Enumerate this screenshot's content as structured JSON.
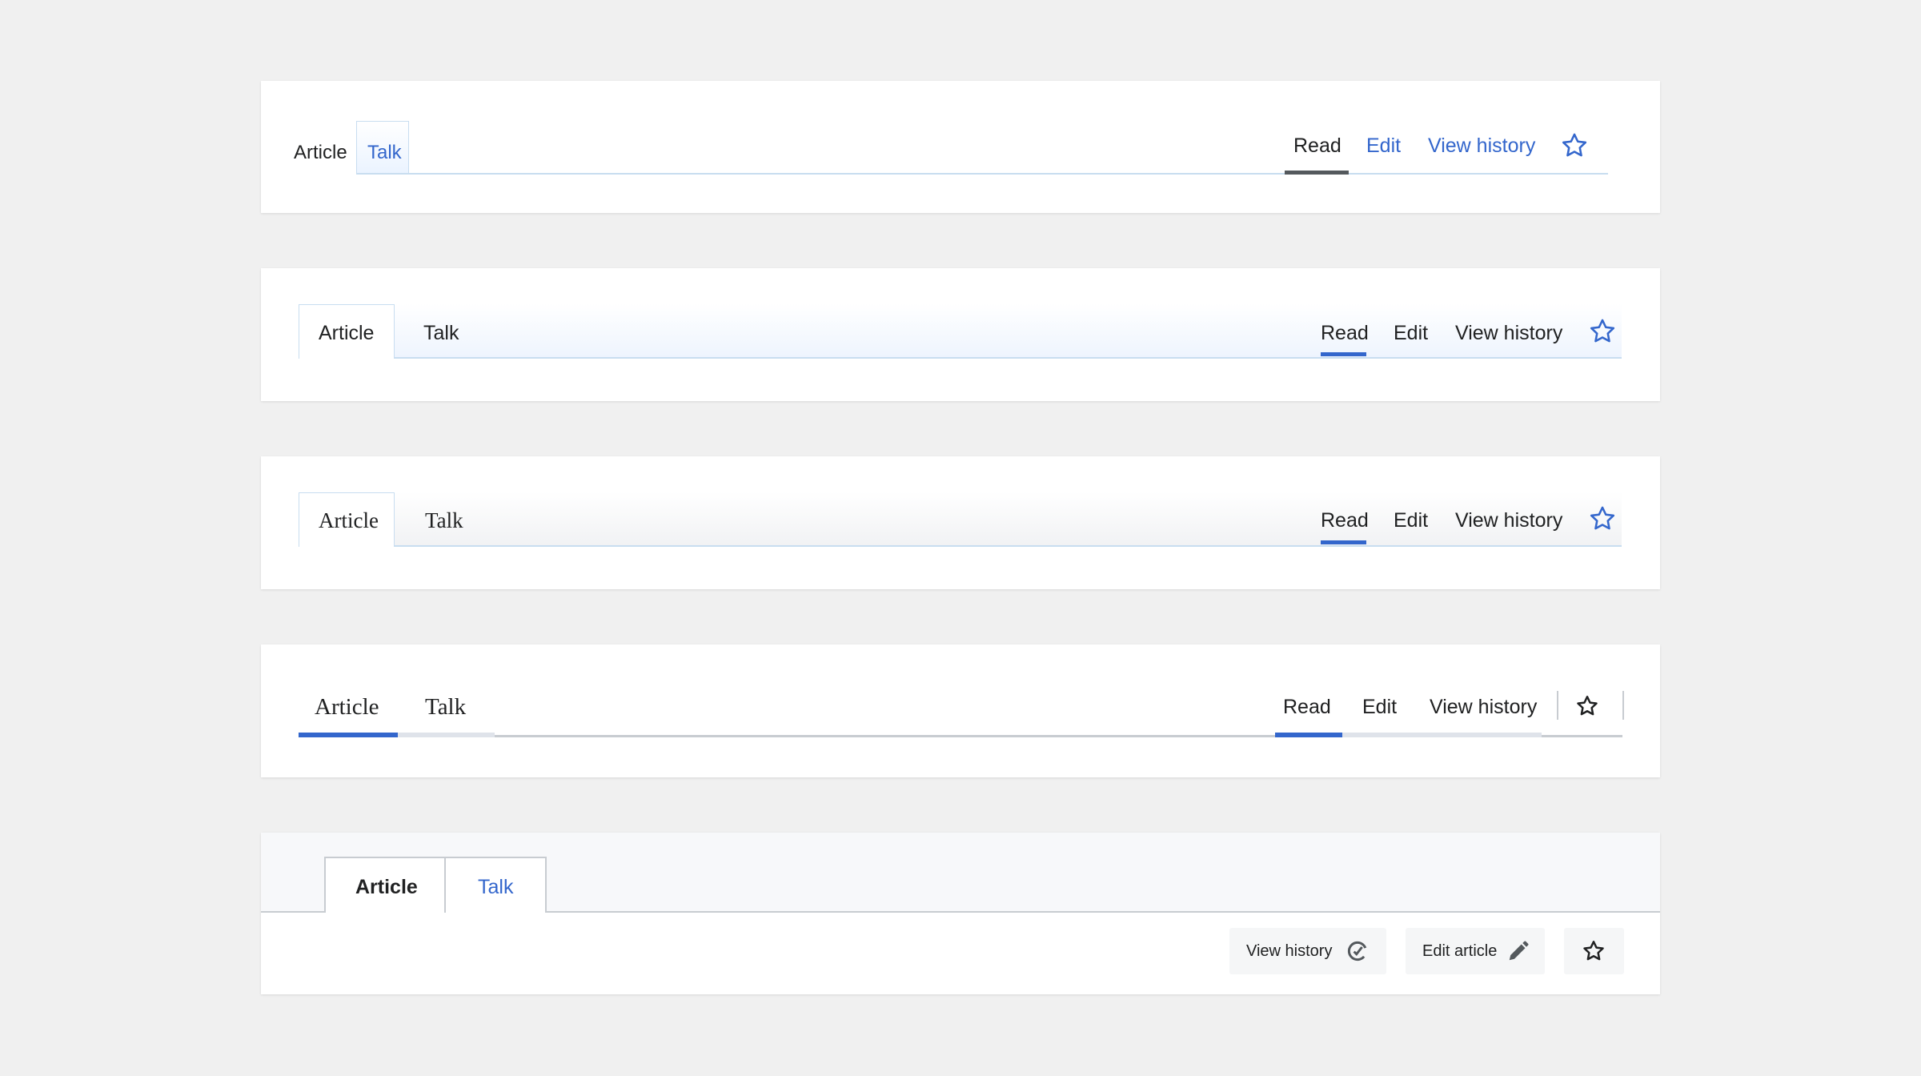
{
  "variant1": {
    "tabs": {
      "article": "Article",
      "talk": "Talk"
    },
    "views": {
      "read": "Read",
      "edit": "Edit",
      "history": "View history"
    },
    "icons": {
      "watch": "star-icon"
    },
    "colors": {
      "link": "#3366cc",
      "selected_underline": "#54595d",
      "border": "#c8ddf0"
    }
  },
  "variant2": {
    "tabs": {
      "article": "Article",
      "talk": "Talk"
    },
    "views": {
      "read": "Read",
      "edit": "Edit",
      "history": "View history"
    },
    "icons": {
      "watch": "star-icon"
    },
    "colors": {
      "accent": "#3366cc"
    }
  },
  "variant3": {
    "tabs": {
      "article": "Article",
      "talk": "Talk"
    },
    "views": {
      "read": "Read",
      "edit": "Edit",
      "history": "View history"
    },
    "icons": {
      "watch": "star-icon"
    },
    "colors": {
      "accent": "#3366cc"
    }
  },
  "variant4": {
    "tabs": {
      "article": "Article",
      "talk": "Talk"
    },
    "views": {
      "read": "Read",
      "edit": "Edit",
      "history": "View history"
    },
    "icons": {
      "watch": "star-outline-icon"
    },
    "colors": {
      "accent": "#3366cc",
      "rule": "#c8ccd1"
    }
  },
  "variant5": {
    "tabs": {
      "article": "Article",
      "talk": "Talk"
    },
    "buttons": {
      "history": "View history",
      "edit": "Edit article"
    },
    "icons": {
      "history": "history-icon",
      "edit": "pencil-icon",
      "watch": "star-outline-icon"
    },
    "colors": {
      "link": "#3366cc",
      "button_bg": "#f5f6f7"
    }
  }
}
